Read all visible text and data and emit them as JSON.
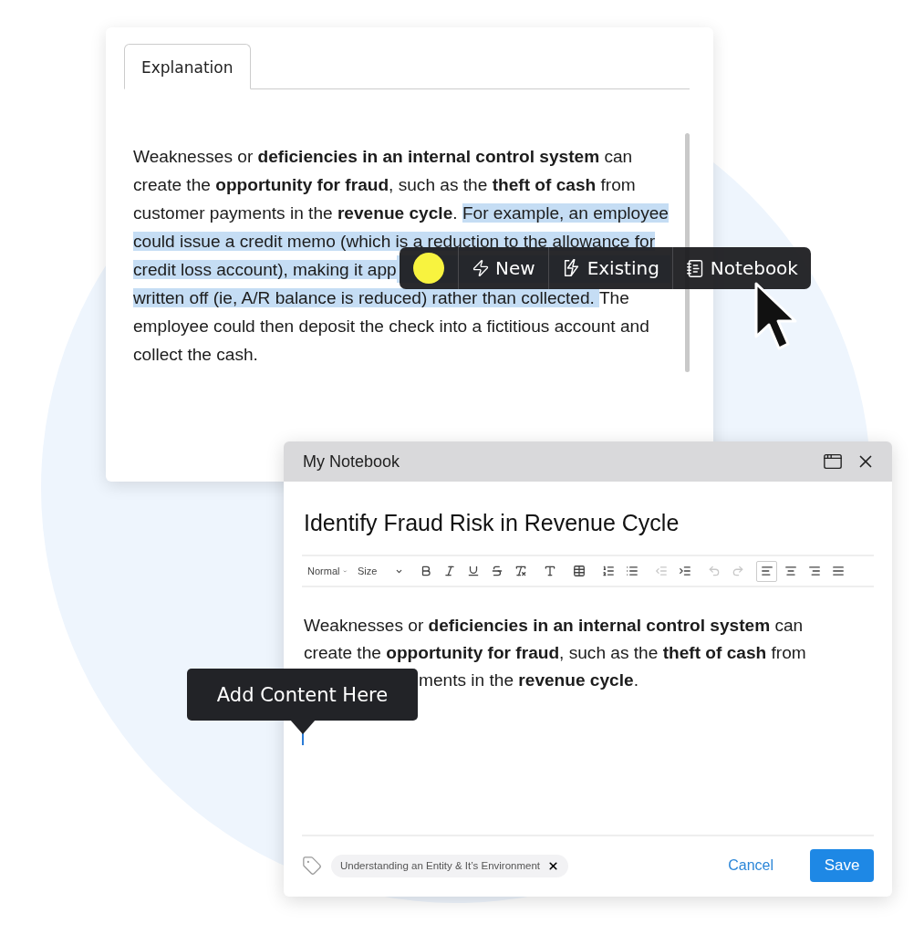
{
  "explanation_panel": {
    "tab": {
      "label": "Explanation",
      "selected": true
    },
    "paragraph": [
      {
        "text": "Weaknesses or **deficiencies in an internal control system** can create the **opportunity for fraud**, such as the **theft of cash** from customer payments in the **revenue cycle**. ",
        "highlighted": false
      },
      {
        "text": " For example, an employee could issue a credit memo (which is a reduction to the allowance for credit loss account), making it app",
        "highlighted": true
      },
      {
        "text": "written off (ie, A/R balance is reduced) rather than collected. ",
        "highlighted": true
      },
      {
        "text": " The employee could then deposit the check into a fictitious account and collect the cash.",
        "highlighted": false
      }
    ]
  },
  "selection_toolbar": {
    "colors": [
      {
        "color": "#f8f33f"
      }
    ],
    "actions": [
      {
        "label": "New"
      },
      {
        "label": "Existing"
      },
      {
        "label": "Notebook"
      }
    ]
  },
  "notebook": {
    "title": "My Notebook",
    "note_title": "Identify Fraud Risk in Revenue Cycle",
    "editor_toolbar": {
      "format": "Normal",
      "size": "Size",
      "tools": [
        {
          "disabled": false,
          "selected": false
        },
        {
          "disabled": false,
          "selected": false
        },
        {
          "disabled": false,
          "selected": false
        },
        {
          "disabled": false,
          "selected": false
        },
        {
          "disabled": false,
          "selected": false
        },
        {
          "disabled": false,
          "selected": false
        },
        {
          "disabled": false,
          "selected": false
        },
        {
          "disabled": false,
          "selected": false
        },
        {
          "disabled": false,
          "selected": false
        },
        {
          "disabled": true,
          "selected": false
        },
        {
          "disabled": false,
          "selected": false
        },
        {
          "disabled": true,
          "selected": false
        },
        {
          "disabled": true,
          "selected": false
        },
        {
          "disabled": false,
          "selected": true
        },
        {
          "disabled": false,
          "selected": false
        },
        {
          "disabled": false,
          "selected": false
        },
        {
          "disabled": false,
          "selected": false
        }
      ]
    },
    "body": [
      "Weaknesses or **deficiencies in an internal control system** can create the **opportunity for fraud**, such as the **theft of cash** from",
      "ments in the **revenue cycle**."
    ],
    "tooltip": "Add Content Here",
    "tag": "Understanding an Entity & It’s Environment",
    "buttons": [
      {
        "label": "Cancel",
        "kind": "link"
      },
      {
        "label": "Save",
        "kind": "primary"
      }
    ]
  }
}
